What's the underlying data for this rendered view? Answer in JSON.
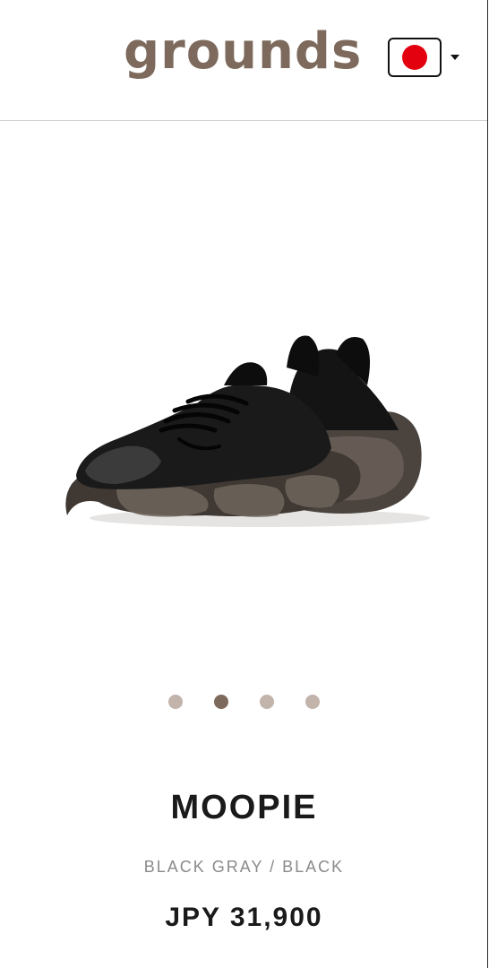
{
  "header": {
    "logo_text": "grounds",
    "locale_flag": "japan-flag-icon",
    "locale_caret": "chevron-down-icon"
  },
  "gallery": {
    "image": "black-sneaker-product-image",
    "dots": [
      "1",
      "2",
      "3",
      "4"
    ],
    "active_index": 1
  },
  "product": {
    "name": "MOOPIE",
    "variant": "BLACK GRAY / BLACK",
    "price": "JPY 31,900"
  },
  "colors": {
    "brand": "#7d6a5d",
    "dot_inactive": "#c2b4ab",
    "flag_red": "#e3000f"
  }
}
